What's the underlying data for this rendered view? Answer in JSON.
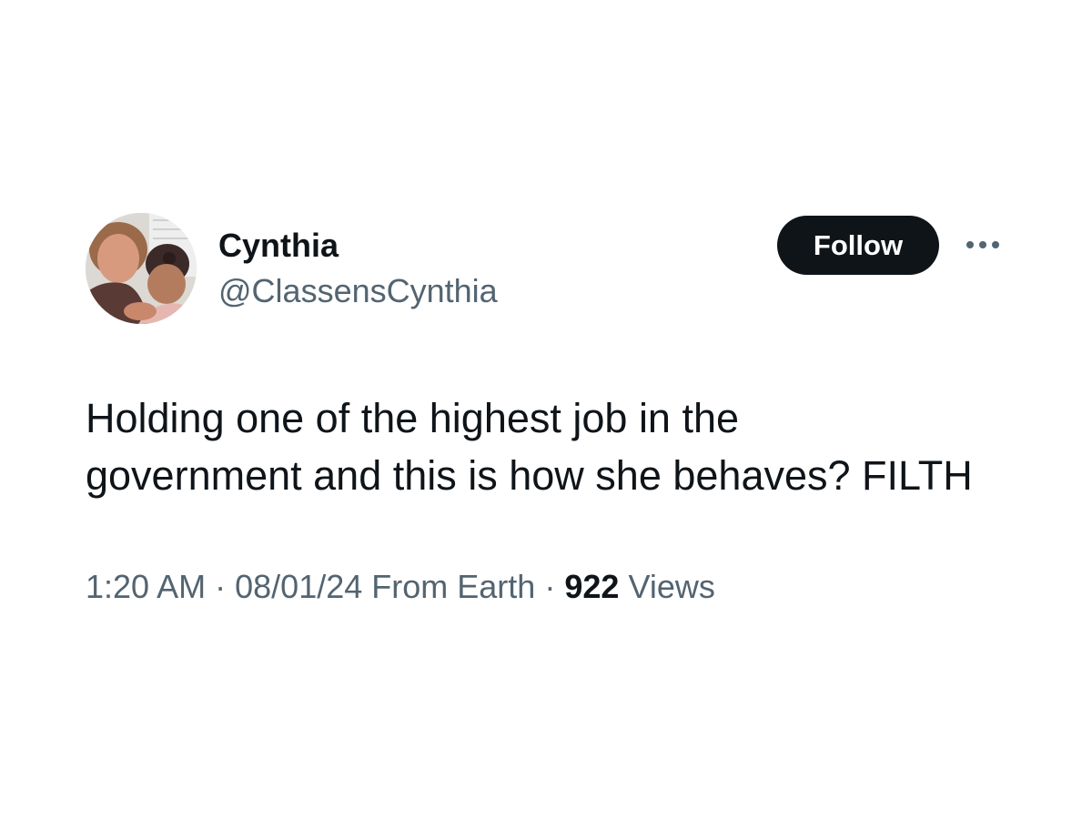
{
  "user": {
    "display_name": "Cynthia",
    "handle": "@ClassensCynthia",
    "avatar_icon": "profile-photo"
  },
  "actions": {
    "follow_label": "Follow",
    "more_icon": "more-horizontal-icon"
  },
  "tweet": {
    "text_lines": [
      "Holding one of the highest job in the",
      "government and this is how she behaves? FILTH"
    ]
  },
  "meta": {
    "time": "1:20 AM",
    "separator": "·",
    "date": "08/01/24",
    "source": "From Earth",
    "views_count": "922",
    "views_label": "Views"
  },
  "colors": {
    "text_primary": "#0f1419",
    "text_secondary": "#536471",
    "follow_bg": "#0f1419",
    "background": "#ffffff"
  }
}
